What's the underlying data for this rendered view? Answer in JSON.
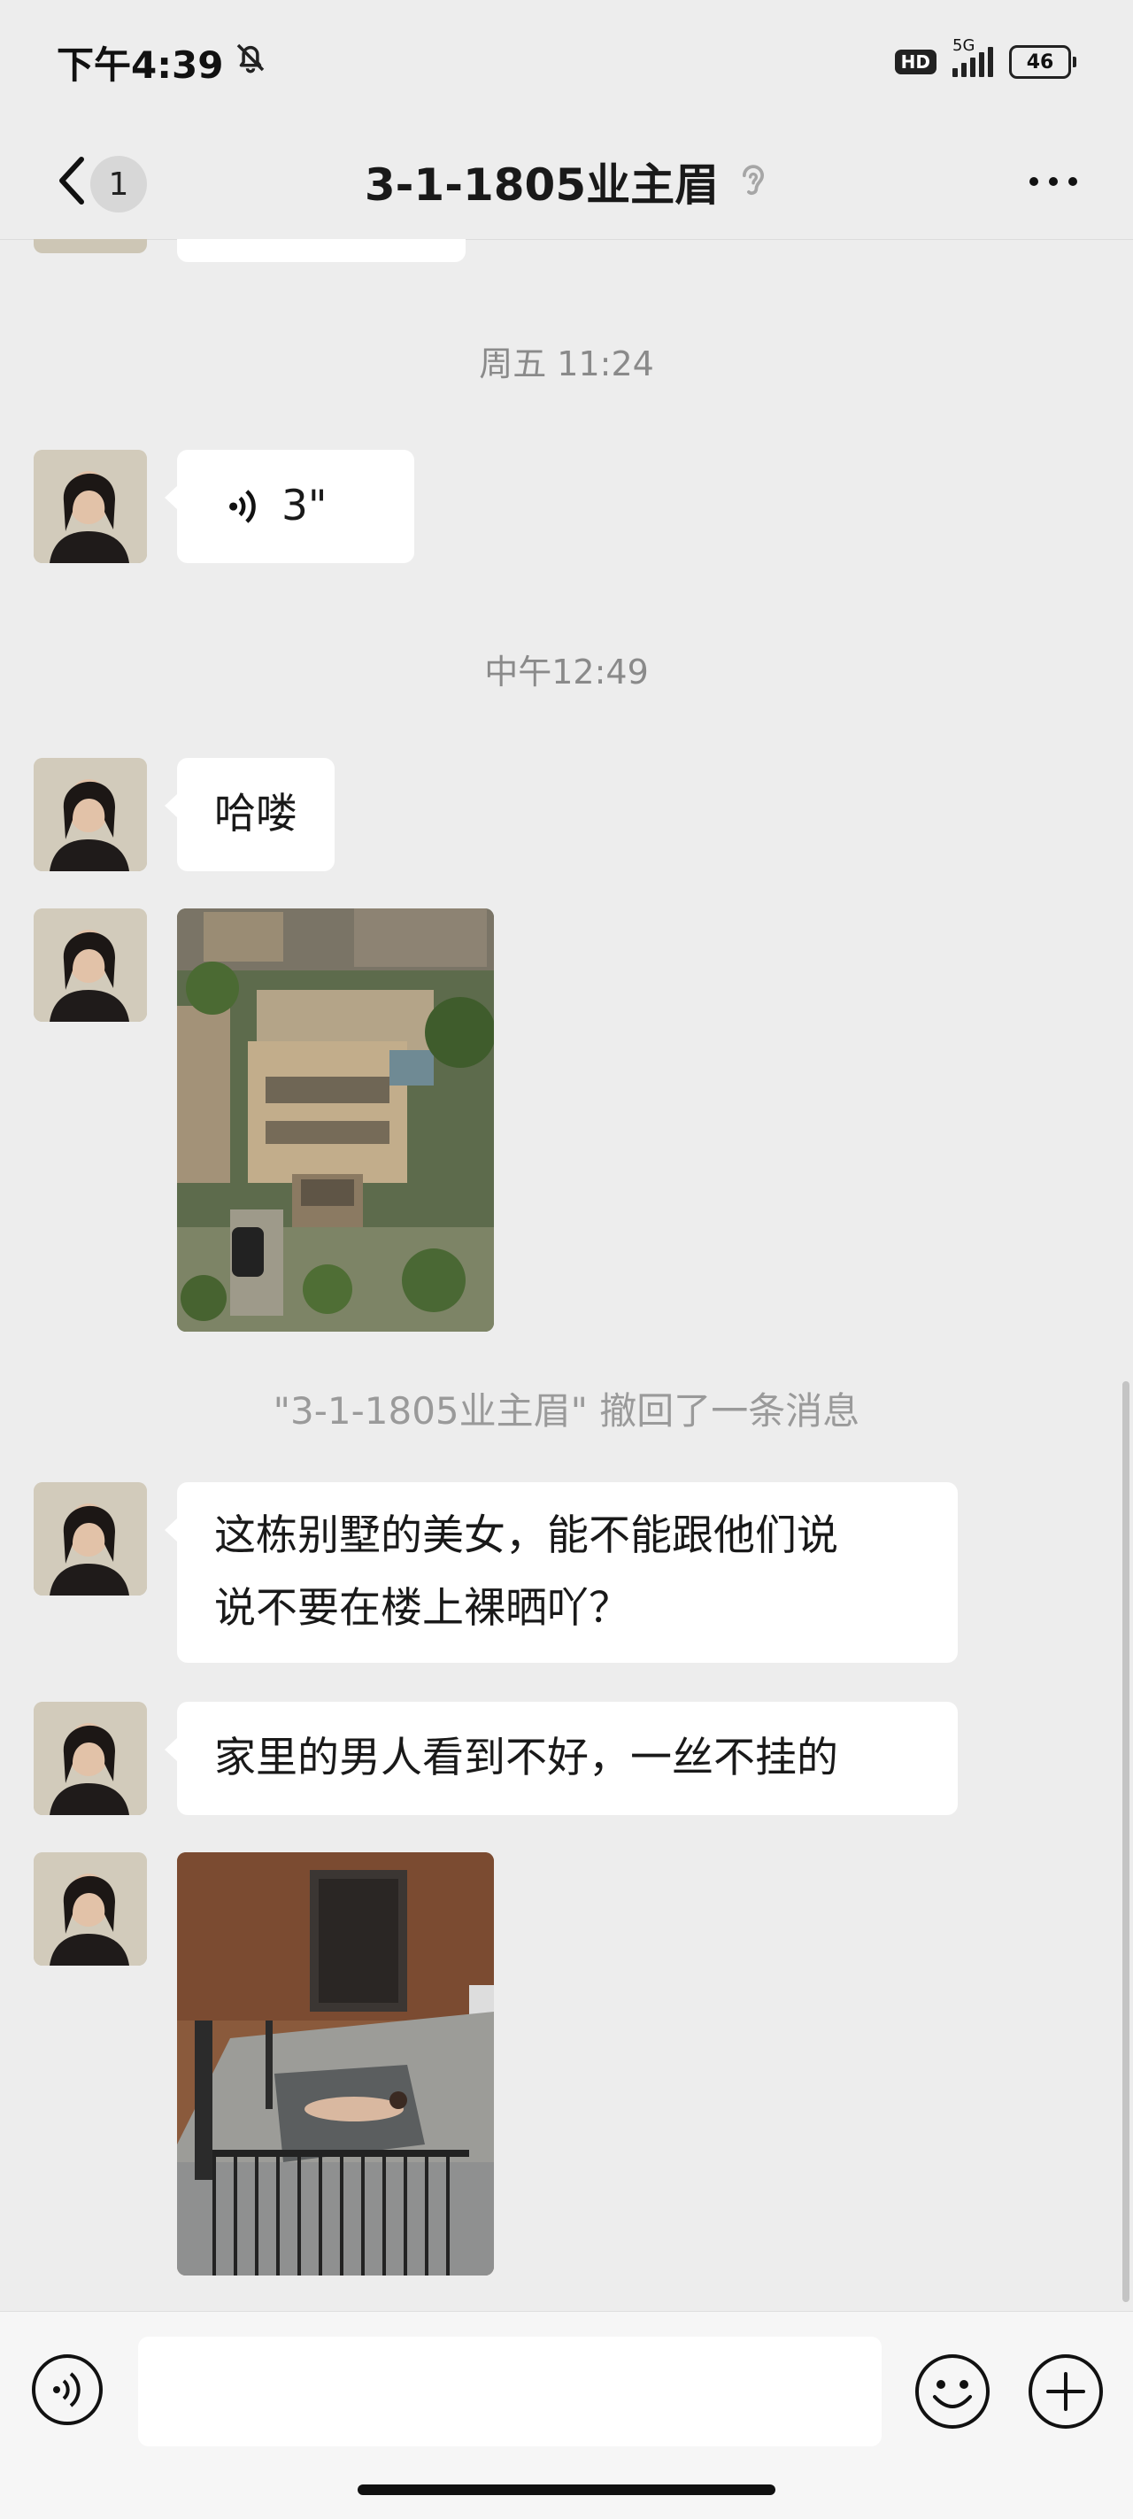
{
  "status_bar": {
    "time": "下午4:39",
    "network": "5G",
    "hd_badge": "HD",
    "battery": "46",
    "icons": [
      "bell-muted-icon",
      "signal-icon",
      "battery-icon"
    ]
  },
  "header": {
    "unread_count": "1",
    "title": "3-1-1805业主眉",
    "icons": [
      "back-arrow-icon",
      "ear-icon",
      "more-dots-icon"
    ]
  },
  "messages": [
    {
      "type": "timestamp",
      "text": "周五 11:24"
    },
    {
      "type": "voice",
      "duration": "3\""
    },
    {
      "type": "timestamp",
      "text": "中午12:49"
    },
    {
      "type": "text",
      "text": "哈喽"
    },
    {
      "type": "image",
      "description_icon": "villa-aerial-photo"
    },
    {
      "type": "system",
      "text": "\"3-1-1805业主眉\" 撤回了一条消息"
    },
    {
      "type": "text",
      "lines": [
        "这栋别墅的美女，能不能跟他们说",
        "说不要在楼上裸晒吖？"
      ]
    },
    {
      "type": "text",
      "text": "家里的男人看到不好，一丝不挂的"
    },
    {
      "type": "image",
      "description_icon": "rooftop-terrace-photo"
    }
  ],
  "input_bar": {
    "placeholder": "",
    "icons": [
      "voice-toggle-icon",
      "emoji-icon",
      "plus-icon"
    ]
  },
  "colors": {
    "background": "#ededed",
    "bubble": "#ffffff",
    "timestamp": "#8a8a8a"
  }
}
